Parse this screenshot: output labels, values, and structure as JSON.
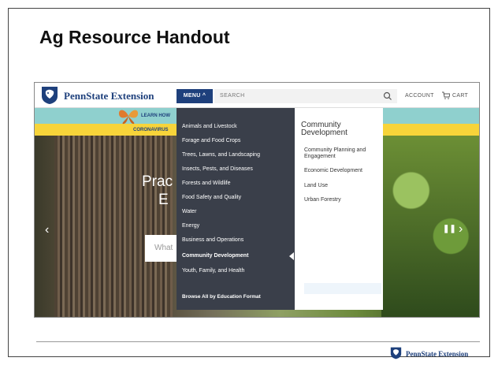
{
  "slide": {
    "title": "Ag Resource Handout",
    "footer_logo": "PennState Extension"
  },
  "header": {
    "logo": "PennState Extension",
    "menu_label": "MENU ^",
    "search_placeholder": "SEARCH",
    "account_label": "ACCOUNT",
    "cart_label": "CART"
  },
  "banners": {
    "learn_label": "LEARN HOW",
    "corona_label": "CORONAVIRUS"
  },
  "hero": {
    "heading_1": "Prac",
    "heading_2": "E",
    "search_placeholder": "What"
  },
  "menu": {
    "items": [
      {
        "label": "Animals and Livestock"
      },
      {
        "label": "Forage and Food Crops"
      },
      {
        "label": "Trees, Lawns, and Landscaping"
      },
      {
        "label": "Insects, Pests, and Diseases"
      },
      {
        "label": "Forests and Wildlife"
      },
      {
        "label": "Food Safety and Quality"
      },
      {
        "label": "Water"
      },
      {
        "label": "Energy"
      },
      {
        "label": "Business and Operations"
      },
      {
        "label": "Community Development"
      },
      {
        "label": "Youth, Family, and Health"
      }
    ],
    "active": "Community Development",
    "browse_all": "Browse All by Education Format"
  },
  "submenu": {
    "title_line_1": "Community",
    "title_line_2": "Development",
    "items": [
      {
        "label": "Community Planning and",
        "label2": "Engagement"
      },
      {
        "label": "Economic Development"
      },
      {
        "label": "Land Use"
      },
      {
        "label": "Urban Forestry"
      }
    ]
  },
  "colors": {
    "brand_navy": "#1e407c",
    "menu_dark": "#3a3f4a",
    "teal_banner": "#8fd0ce",
    "yellow_banner": "#f7d43a"
  }
}
